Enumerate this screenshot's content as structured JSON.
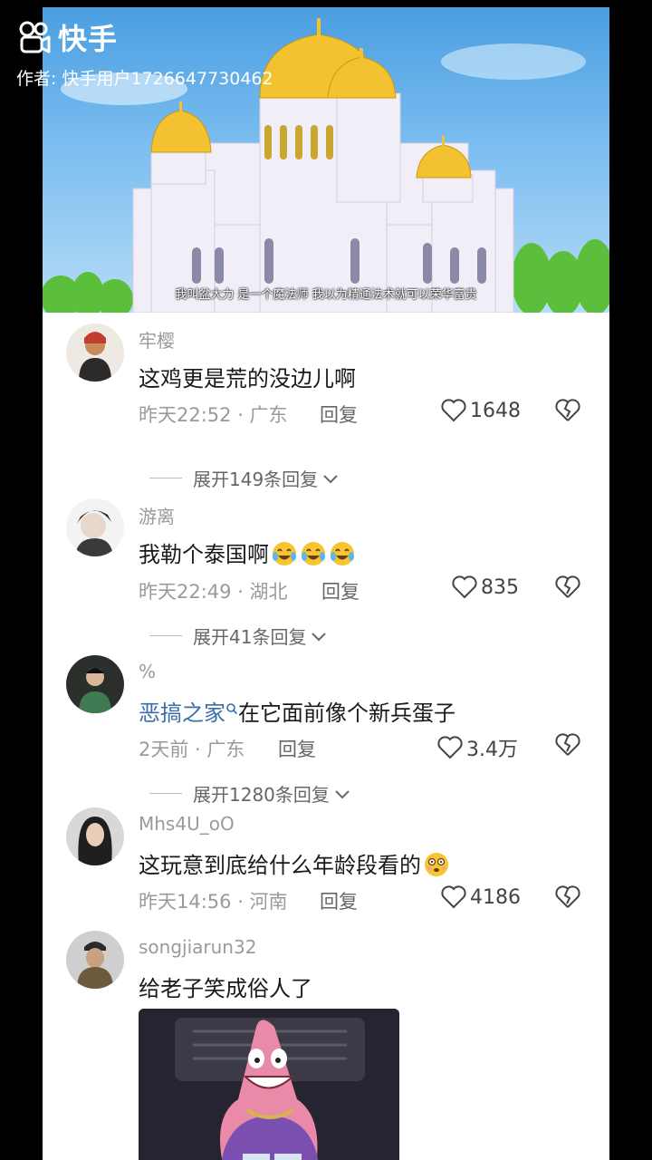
{
  "app": {
    "logo_text": "快手",
    "author": "作者: 快手用户1726647730462"
  },
  "video": {
    "subtitle": "我叫盆大力 是一个魔法师 我以为精通法术就可以荣华富贵"
  },
  "comments": [
    {
      "name": "牢樱",
      "text": "这鸡更是荒的没边儿啊",
      "time": "昨天22:52 · 广东",
      "reply": "回复",
      "likes": "1648",
      "expand": "展开149条回复"
    },
    {
      "name": "游离",
      "text": "我勒个泰国啊",
      "emojis": [
        "crying-laugh-emoji",
        "crying-laugh-emoji",
        "crying-laugh-emoji"
      ],
      "time": "昨天22:49 · 湖北",
      "reply": "回复",
      "likes": "835",
      "expand": "展开41条回复"
    },
    {
      "name": "%",
      "mention": "恶搞之家",
      "text": "在它面前像个新兵蛋子",
      "time": "2天前 · 广东",
      "reply": "回复",
      "likes": "3.4万",
      "expand": "展开1280条回复"
    },
    {
      "name": "Mhs4U_oO",
      "text": "这玩意到底给什么年龄段看的",
      "emojis": [
        "dizzy-face-emoji"
      ],
      "time": "昨天14:56 · 河南",
      "reply": "回复",
      "likes": "4186"
    },
    {
      "name": "songjiarun32",
      "text": "给老子笑成俗人了"
    }
  ],
  "colors": {
    "name_gray": "#9a9a9a",
    "text_dark": "#1a1a1a",
    "mention_blue": "#3a6ea8",
    "panel_bg": "#ffffff"
  }
}
